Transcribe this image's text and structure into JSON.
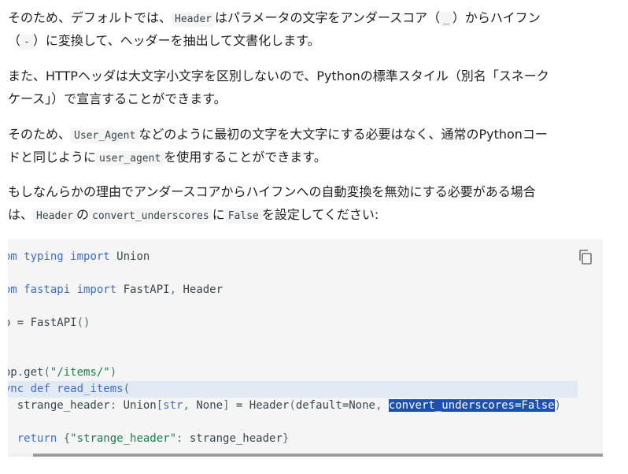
{
  "p1": {
    "l1_a": "そのため、デフォルトでは、",
    "l1_code": "Header",
    "l1_b": "はパラメータの文字をアンダースコア（",
    "l1_code2": "_",
    "l1_c": "）からハイフン",
    "l2_a": "（",
    "l2_code": "-",
    "l2_b": "）に変換して、ヘッダーを抽出して文書化します。"
  },
  "p2": {
    "l1": "また、HTTPヘッダは大文字小文字を区別しないので、Pythonの標準スタイル（別名「スネーク",
    "l2": "ケース」）で宣言することができます。"
  },
  "p3": {
    "l1_a": "そのため、",
    "l1_code": "User_Agent",
    "l1_b": "などのように最初の文字を大文字にする必要はなく、通常のPythonコー",
    "l2_a": "ドと同じように",
    "l2_code": "user_agent",
    "l2_b": "を使用することができます。"
  },
  "p4": {
    "l1": "もしなんらかの理由でアンダースコアからハイフンへの自動変換を無効にする必要がある場合",
    "l2_a": "は、",
    "l2_code1": "Header",
    "l2_b": "の",
    "l2_code2": "convert_underscores",
    "l2_c": "に",
    "l2_code3": "False",
    "l2_d": "を設定してください:"
  },
  "code": {
    "l1": {
      "kw1": "from",
      "mod": " typing ",
      "kw2": "import",
      "name": " Union"
    },
    "l2": {
      "kw1": "from",
      "mod": " fastapi ",
      "kw2": "import",
      "name": " FastAPI",
      "comma": ",",
      "name2": " Header"
    },
    "l3": {
      "var": "app ",
      "op": "=",
      "call": " FastAPI",
      "paren": "()"
    },
    "l4": {
      "dec": "@app",
      "dot": ".",
      "fn": "get",
      "p1": "(",
      "str": "\"/items/\"",
      "p2": ")"
    },
    "l5": {
      "kw": "async def",
      "fn": " read_items",
      "p": "("
    },
    "l6": {
      "pre": "    strange_header",
      "colon": ":",
      "t1": " Union",
      "b1": "[",
      "t2": "str",
      "comma": ",",
      "t3": " None",
      "b2": "]",
      "eq": " =",
      "call": " Header",
      "p1": "(",
      "arg": "default=None",
      "comma2": ", ",
      "sel": "convert_underscores=False",
      "p2": ")"
    },
    "l7": {
      "pre": "    ",
      "kw": "return",
      "b1": " {",
      "str": "\"strange_header\"",
      "colon": ":",
      "val": " strange_header",
      "b2": "}"
    }
  },
  "icons": {
    "copy": "copy-icon"
  },
  "colors": {
    "keyword": "#3f6ec6",
    "string": "#1c7d4d",
    "selection": "#1e50b3",
    "code_bg": "#f5f5f5"
  }
}
